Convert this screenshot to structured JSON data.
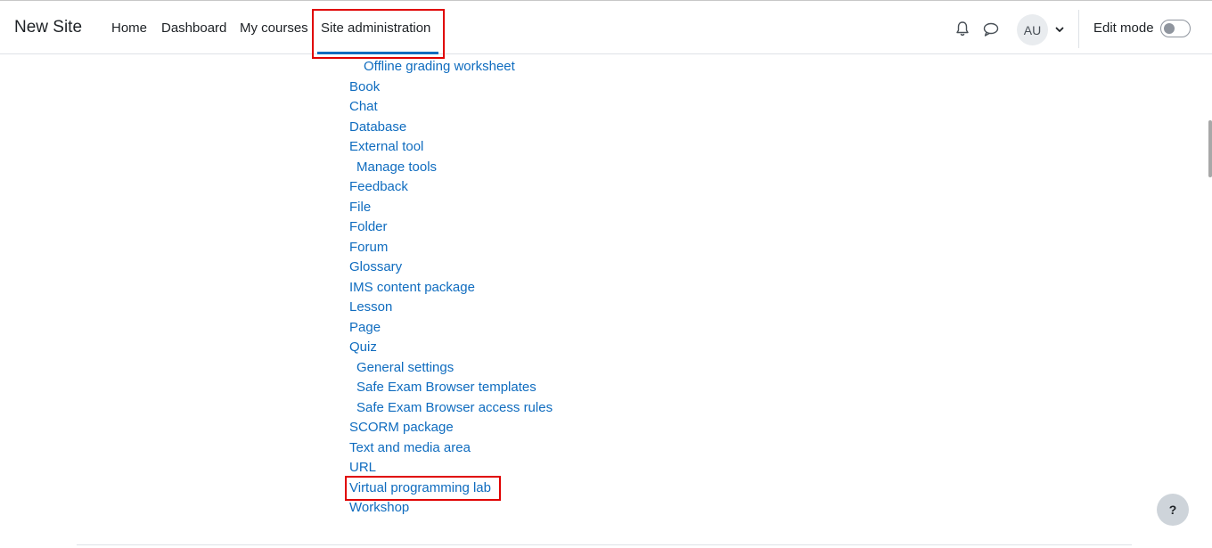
{
  "navbar": {
    "brand": "New Site",
    "items": [
      {
        "label": "Home"
      },
      {
        "label": "Dashboard"
      },
      {
        "label": "My courses"
      },
      {
        "label": "Site administration",
        "active": true
      }
    ],
    "avatar_initials": "AU",
    "edit_mode_label": "Edit mode",
    "edit_mode_on": false,
    "icons": [
      "bell-icon",
      "message-icon",
      "chevron-down-icon"
    ]
  },
  "content": {
    "links": [
      {
        "label": "Offline grading worksheet",
        "level": 2
      },
      {
        "label": "Book",
        "level": 0
      },
      {
        "label": "Chat",
        "level": 0
      },
      {
        "label": "Database",
        "level": 0
      },
      {
        "label": "External tool",
        "level": 0
      },
      {
        "label": "Manage tools",
        "level": 1
      },
      {
        "label": "Feedback",
        "level": 0
      },
      {
        "label": "File",
        "level": 0
      },
      {
        "label": "Folder",
        "level": 0
      },
      {
        "label": "Forum",
        "level": 0
      },
      {
        "label": "Glossary",
        "level": 0
      },
      {
        "label": "IMS content package",
        "level": 0
      },
      {
        "label": "Lesson",
        "level": 0
      },
      {
        "label": "Page",
        "level": 0
      },
      {
        "label": "Quiz",
        "level": 0
      },
      {
        "label": "General settings",
        "level": 1
      },
      {
        "label": "Safe Exam Browser templates",
        "level": 1
      },
      {
        "label": "Safe Exam Browser access rules",
        "level": 1
      },
      {
        "label": "SCORM package",
        "level": 0
      },
      {
        "label": "Text and media area",
        "level": 0
      },
      {
        "label": "URL",
        "level": 0
      },
      {
        "label": "Virtual programming lab",
        "level": 0,
        "highlighted": true
      },
      {
        "label": "Workshop",
        "level": 0
      }
    ]
  },
  "help_button_label": "?",
  "colors": {
    "link": "#0f6cbf",
    "highlight": "#e00000",
    "active_underline": "#0f6cbf"
  }
}
